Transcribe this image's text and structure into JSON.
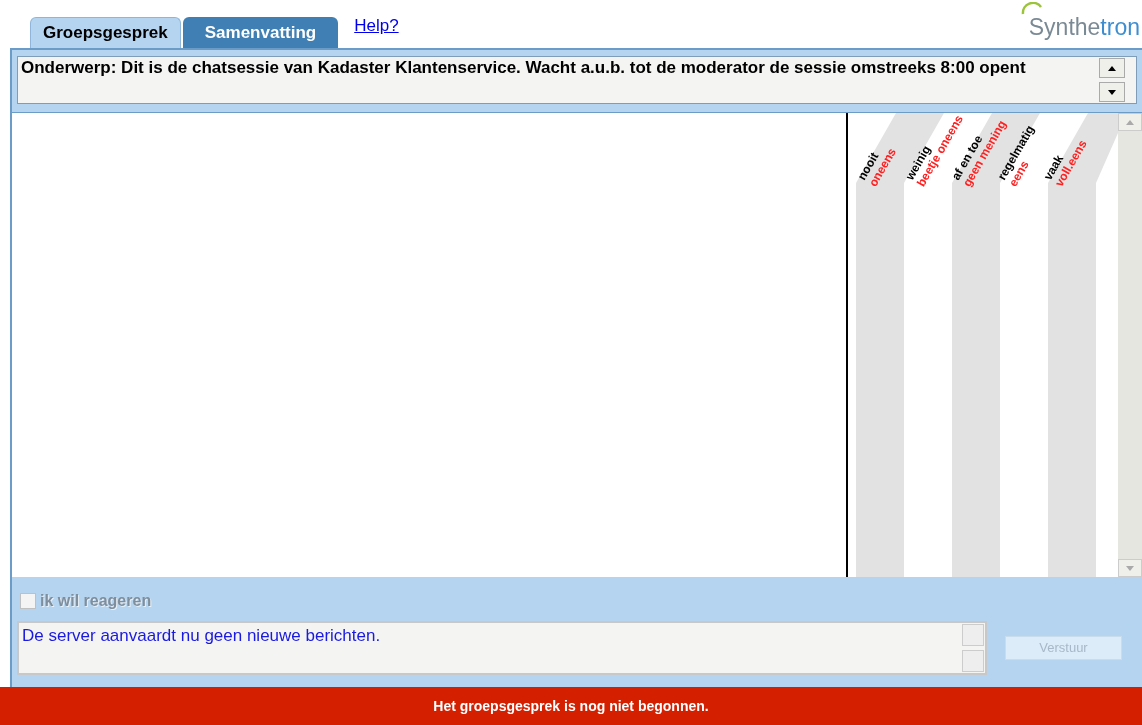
{
  "tabs": [
    {
      "label": "Groepsgesprek",
      "selected": true
    },
    {
      "label": "Samenvatting",
      "selected": false
    }
  ],
  "help_link": "Help?",
  "logo": {
    "part_1": "Synthe",
    "part_2": "tron"
  },
  "topic": "Onderwerp: Dit is de chatsessie van Kadaster Klantenservice. Wacht a.u.b. tot de moderator de sessie omstreeks 8:00 opent",
  "rating_headers": [
    {
      "frequency": "nooit",
      "opinion": "oneens"
    },
    {
      "frequency": "weinig",
      "opinion": "beetje oneens"
    },
    {
      "frequency": "af en toe",
      "opinion": "geen mening"
    },
    {
      "frequency": "regelmatig",
      "opinion": "eens"
    },
    {
      "frequency": "vaak",
      "opinion": "voll.eens"
    }
  ],
  "react_checkbox": {
    "label": "ik wil reageren",
    "checked": false,
    "disabled": true
  },
  "message_field": {
    "value": "De server aanvaardt nu geen nieuwe berichten."
  },
  "send_button": {
    "label": "Verstuur",
    "disabled": true
  },
  "status_bar": "Het groepsgesprek is nog niet begonnen."
}
